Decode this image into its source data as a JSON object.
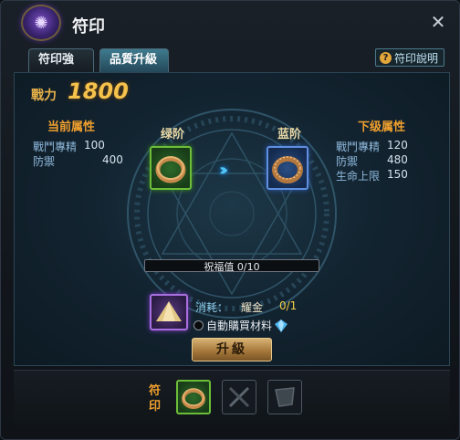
{
  "window": {
    "title": "符印",
    "close_icon": "close-icon"
  },
  "tabs": [
    {
      "label": "符印強化",
      "active": false
    },
    {
      "label": "品質升級",
      "active": true
    }
  ],
  "help": {
    "label": "符印說明",
    "icon": "question-icon"
  },
  "power": {
    "label": "戰力",
    "value": "1800"
  },
  "current": {
    "title": "当前属性",
    "grade": "绿阶",
    "stats": [
      {
        "label": "戰鬥專精",
        "value": "100"
      },
      {
        "label": "防禦",
        "value": "400"
      }
    ]
  },
  "next": {
    "title": "下级属性",
    "grade": "蓝阶",
    "stats": [
      {
        "label": "戰鬥專精",
        "value": "120"
      },
      {
        "label": "防禦",
        "value": "480"
      },
      {
        "label": "生命上限",
        "value": "150"
      }
    ]
  },
  "blessing": {
    "text": "祝福值 0/10",
    "current": 0,
    "max": 10
  },
  "material": {
    "consume_label": "消耗：",
    "name": "耀金",
    "count": "0/1",
    "auto_buy_label": "自動購買材料",
    "auto_buy_checked": false
  },
  "upgrade_button": "升級",
  "footer": {
    "label_line1": "符",
    "label_line2": "印"
  },
  "colors": {
    "accent_gold": "#f5c24c",
    "section_orange": "#f0a02e",
    "grade_green": "#6cbe3a",
    "grade_blue": "#5f8fe0",
    "material_purple": "#a86ee0"
  }
}
